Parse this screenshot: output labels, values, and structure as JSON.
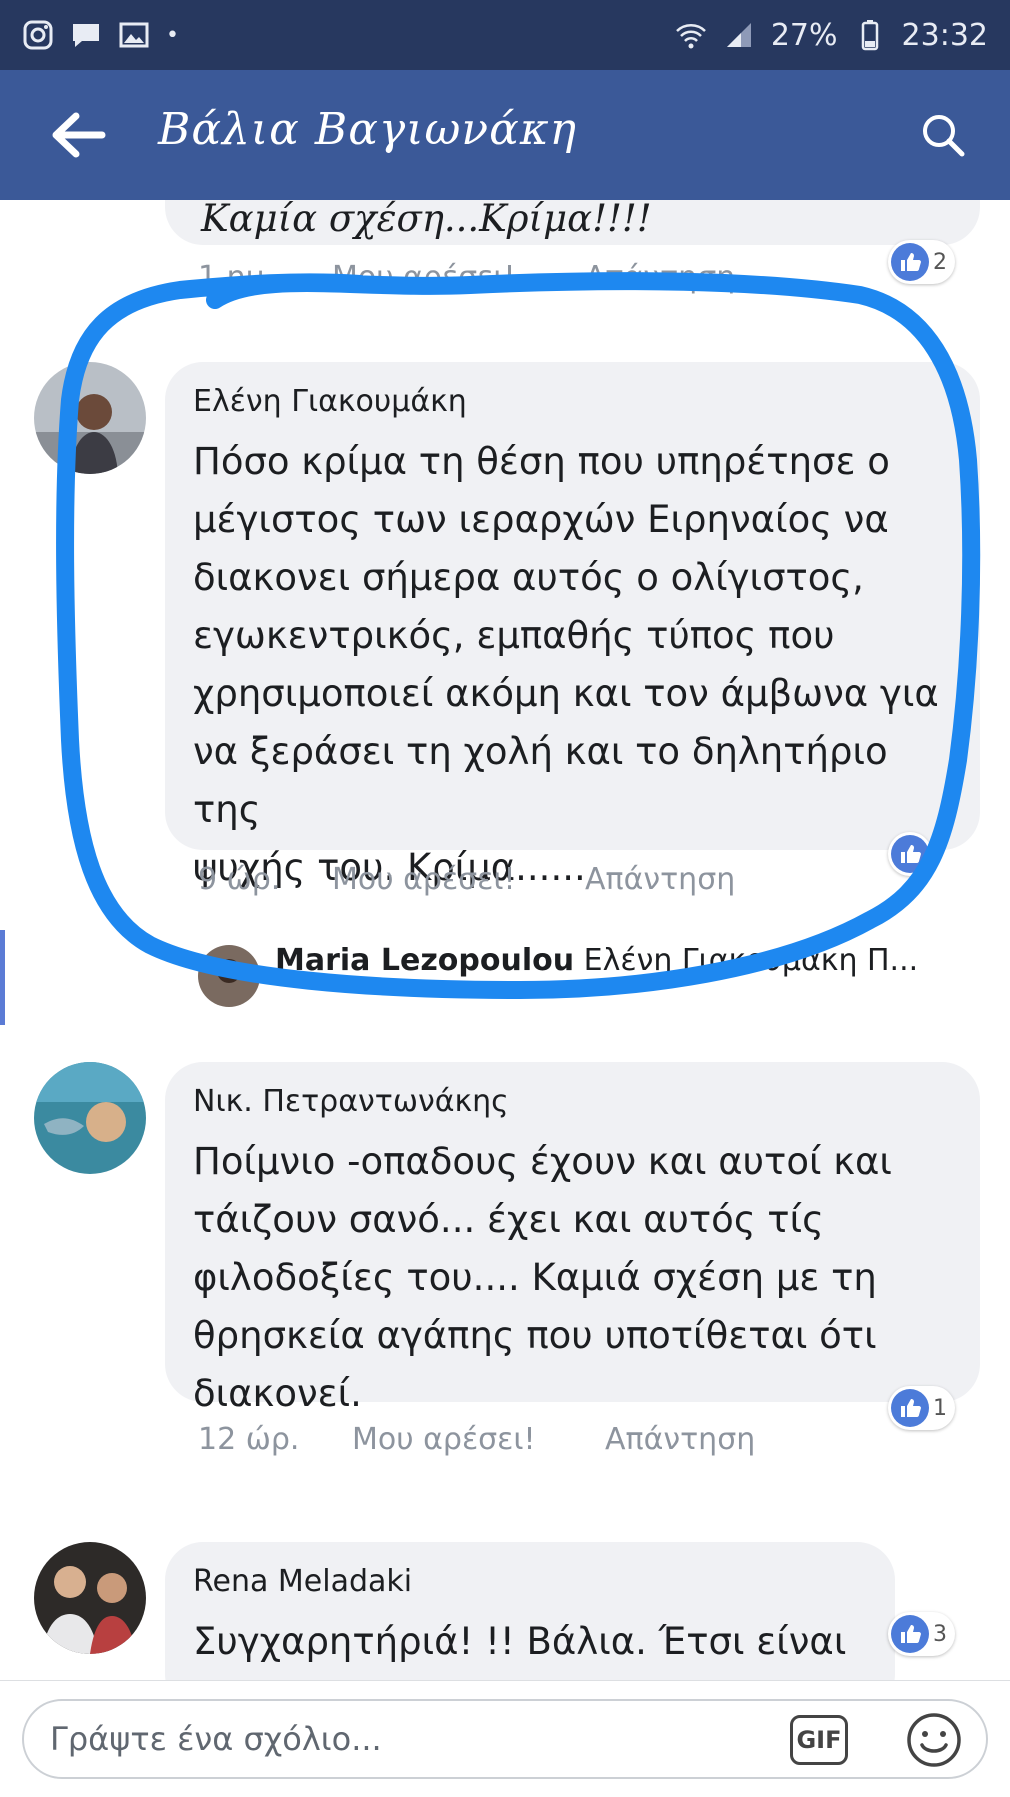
{
  "status_bar": {
    "battery": "27%",
    "time": "23:32"
  },
  "header": {
    "title": "Βάλια Βαγιωνάκη"
  },
  "comments": [
    {
      "text": "Καμία σχέση...Κρίμα!!!!",
      "time": "1 ημ.",
      "like": "Μου αρέσει!",
      "reply": "Απάντηση",
      "likes": "2"
    },
    {
      "author": "Ελένη Γιακουμάκη",
      "text": "Πόσο κρίμα τη θέση που υπηρέτησε ο\nμέγιστος των ιεραρχών Ειρηναίος να\nδιακονει σήμερα αυτός ο ολίγιστος,\nεγωκεντρικός, εμπαθής τύπος που\nχρησιμοποιεί ακόμη και τον άμβωνα για\nνα ξεράσει τη χολή και το δηλητήριο της\nψυχής του. Κρίμα......",
      "time": "9 ώρ.",
      "like": "Μου αρέσει!",
      "reply": "Απάντηση",
      "reply_preview": {
        "author": "Maria Lezopoulou",
        "text": "Ελένη Γιακουμάκη Π..."
      }
    },
    {
      "author": "Νικ. Πετραντωνάκης",
      "text": "Ποίμνιο  -οπαδους έχουν και αυτοί και\nτάιζουν σανό... έχει και αυτός τίς\nφιλοδοξίες του.... Καμιά σχέση με τη\nθρησκεία αγάπης που υποτίθεται ότι\nδιακονεί.",
      "time": "12 ώρ.",
      "like": "Μου αρέσει!",
      "reply": "Απάντηση",
      "likes": "1"
    },
    {
      "author": "Rena Meladaki",
      "text": "Συγχαρητήριά! !!  Βάλια. Έτσι είναι",
      "likes": "3"
    }
  ],
  "composer": {
    "placeholder": "Γράψτε ένα σχόλιο...",
    "gif": "GIF"
  },
  "colors": {
    "header_bg": "#3b5998",
    "status_bg": "#27385f",
    "bubble_bg": "#f0f1f4",
    "like_blue": "#4c7bd9",
    "annotation_blue": "#1e88f0"
  }
}
